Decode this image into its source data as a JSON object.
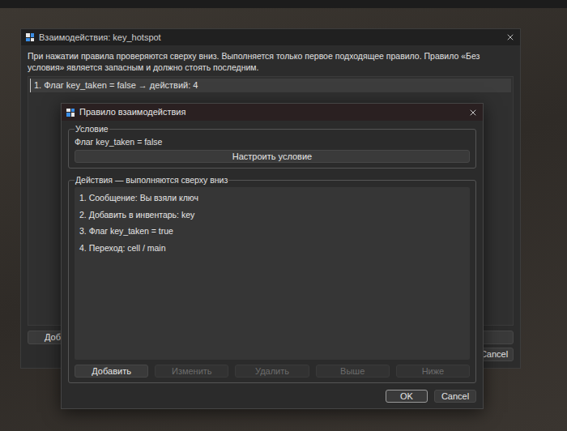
{
  "background_window": {
    "title": "Взаимодействия: key_hotspot",
    "description": "При нажатии правила проверяются сверху вниз. Выполняется только первое подходящее правило. Правило «Без условия» является запасным и должно стоять последним.",
    "rules": [
      {
        "text": "1. Флаг key_taken = false → действий: 4",
        "selected": true
      }
    ],
    "add_button": "Доба",
    "cancel_button": "Cancel"
  },
  "dialog": {
    "title": "Правило взаимодействия",
    "condition_group": {
      "legend": "Условие",
      "text": "Флаг key_taken = false",
      "button": "Настроить условие"
    },
    "actions_group": {
      "legend": "Действия — выполняются сверху вниз",
      "actions": [
        "1. Сообщение: Вы взяли ключ",
        "2. Добавить в инвентарь: key",
        "3. Флаг key_taken = true",
        "4. Переход: cell / main"
      ],
      "buttons": [
        {
          "label": "Добавить",
          "disabled": false
        },
        {
          "label": "Изменить",
          "disabled": true
        },
        {
          "label": "Удалить",
          "disabled": true
        },
        {
          "label": "Выше",
          "disabled": true
        },
        {
          "label": "Ниже",
          "disabled": true
        }
      ]
    },
    "buttons": [
      {
        "label": "OK",
        "focused": true
      },
      {
        "label": "Cancel",
        "focused": false
      }
    ]
  }
}
